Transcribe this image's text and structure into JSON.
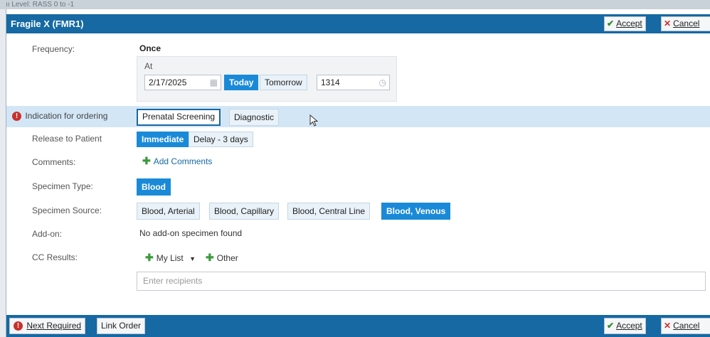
{
  "background_text": "ıı Level: RASS 0 to -1",
  "dialog": {
    "title": "Fragile X (FMR1)",
    "accept_label": "Accept",
    "cancel_label": "Cancel"
  },
  "frequency": {
    "label": "Frequency:",
    "value": "Once"
  },
  "at": {
    "label": "At",
    "date": "2/17/2025",
    "today_label": "Today",
    "tomorrow_label": "Tomorrow",
    "time": "1314"
  },
  "indication": {
    "label": "Indication for ordering",
    "options": [
      "Prenatal Screening",
      "Diagnostic"
    ]
  },
  "release": {
    "label": "Release to Patient",
    "options": [
      "Immediate",
      "Delay - 3 days"
    ],
    "selected": "Immediate"
  },
  "comments": {
    "label": "Comments:",
    "add_label": "Add Comments"
  },
  "specimen_type": {
    "label": "Specimen Type:",
    "options": [
      "Blood"
    ],
    "selected": "Blood"
  },
  "specimen_source": {
    "label": "Specimen Source:",
    "options": [
      "Blood, Arterial",
      "Blood, Capillary",
      "Blood, Central Line",
      "Blood, Venous"
    ],
    "selected": "Blood, Venous"
  },
  "addon": {
    "label": "Add-on:",
    "value": "No add-on specimen found"
  },
  "cc_results": {
    "label": "CC Results:",
    "my_list_label": "My List",
    "other_label": "Other",
    "placeholder": "Enter recipients"
  },
  "footer": {
    "next_required_label": "Next Required",
    "link_order_label": "Link Order",
    "accept_label": "Accept",
    "cancel_label": "Cancel"
  },
  "colors": {
    "title_bar": "#1669a3",
    "selected": "#1a8ad8",
    "highlight_row": "#d3e6f6",
    "error": "#c9302c"
  }
}
